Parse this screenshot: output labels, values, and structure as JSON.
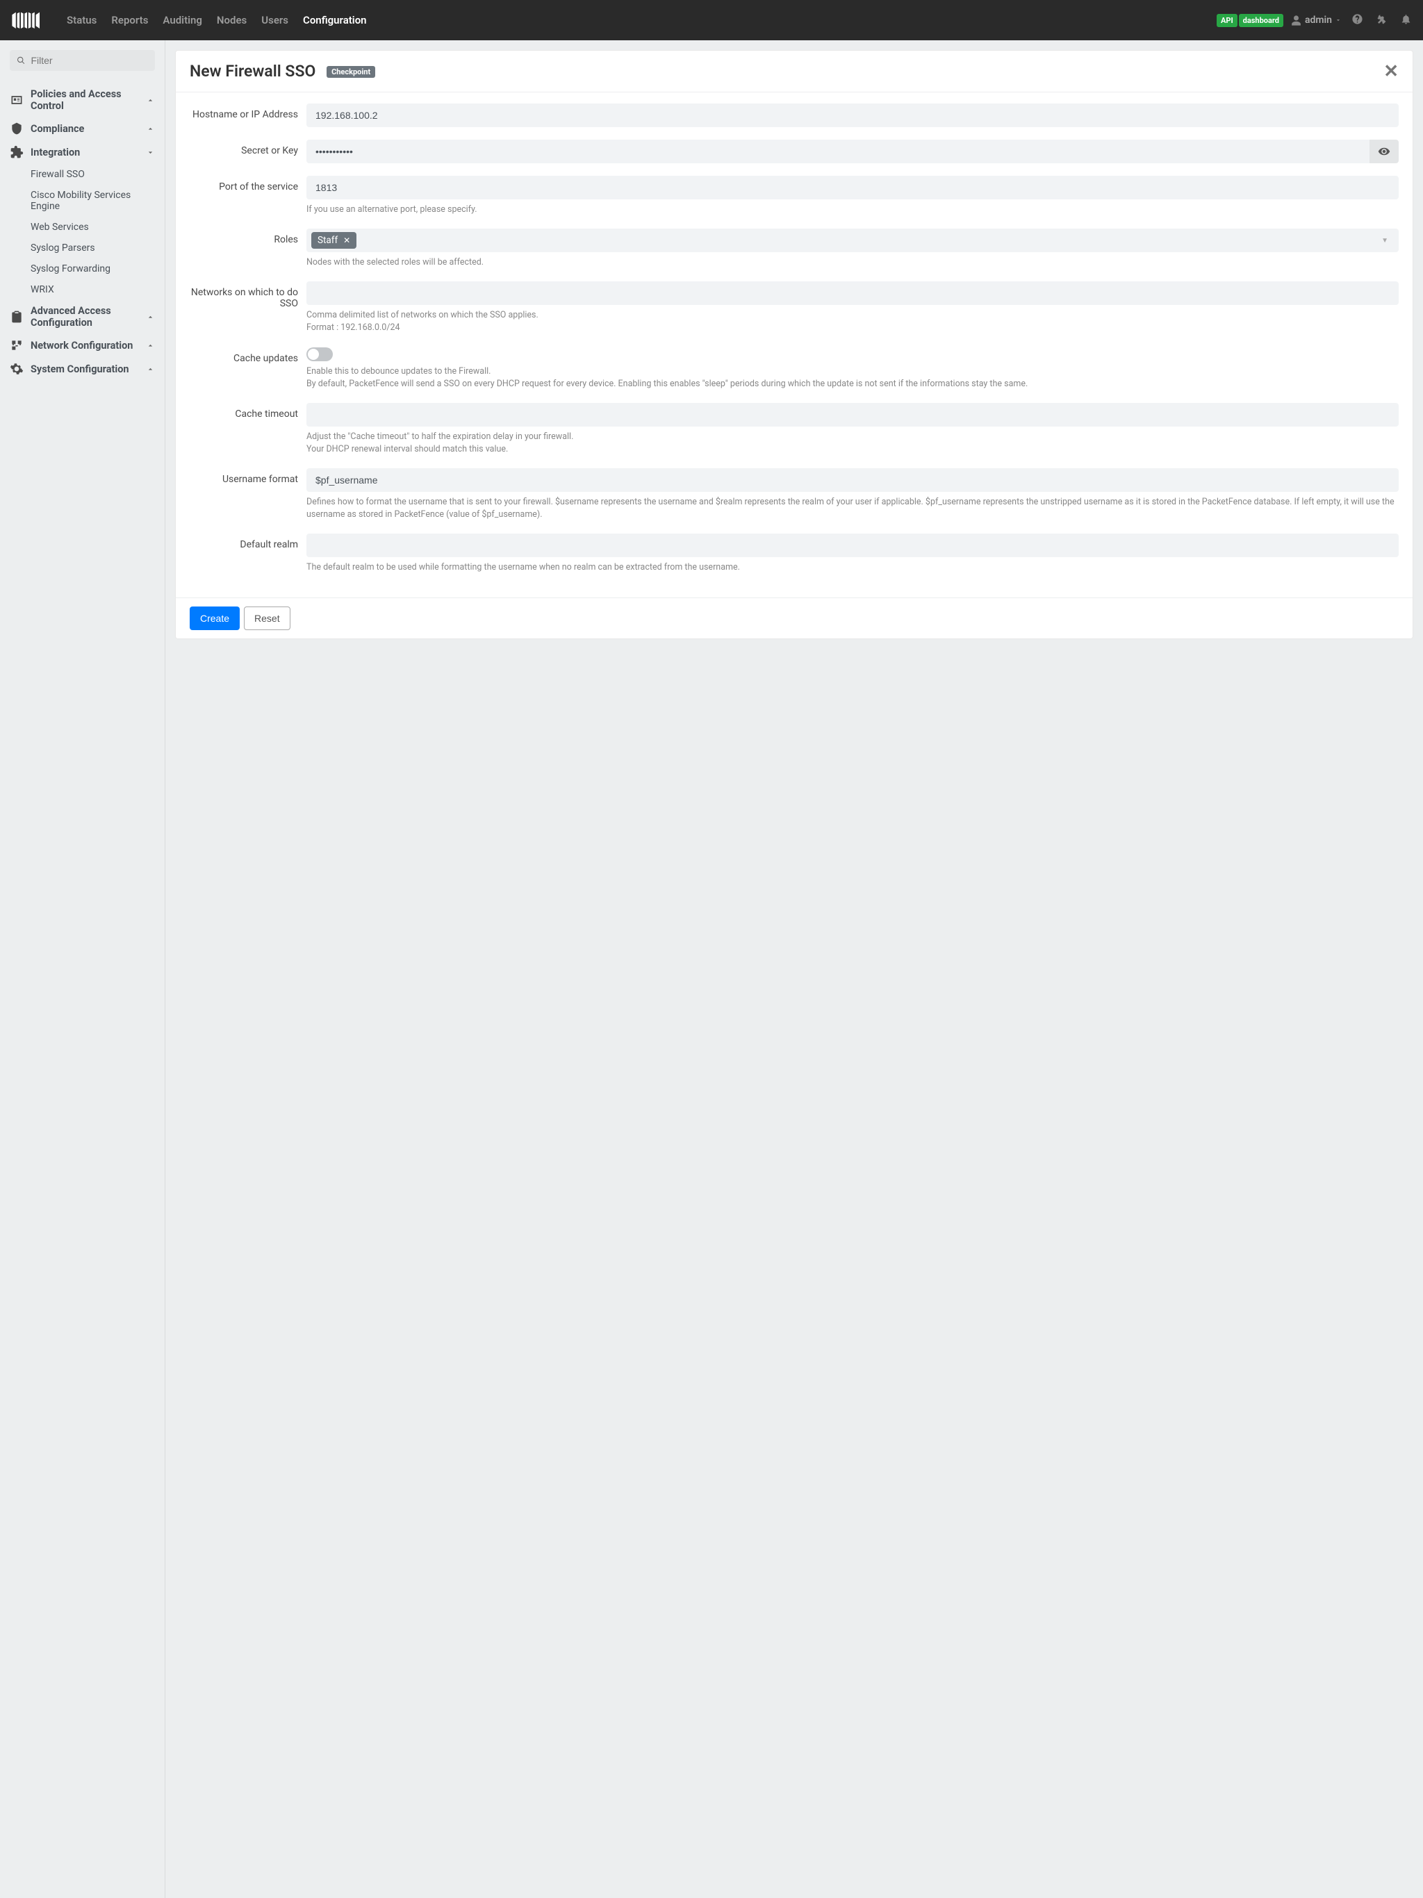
{
  "nav": {
    "items": [
      "Status",
      "Reports",
      "Auditing",
      "Nodes",
      "Users",
      "Configuration"
    ],
    "active_index": 5,
    "badges": {
      "api": "API",
      "dashboard": "dashboard"
    },
    "user": "admin"
  },
  "sidebar": {
    "filter_placeholder": "Filter",
    "sections": [
      {
        "label": "Policies and Access Control",
        "icon": "id-card-icon",
        "collapsed": true
      },
      {
        "label": "Compliance",
        "icon": "shield-icon",
        "collapsed": true
      },
      {
        "label": "Integration",
        "icon": "puzzle-icon",
        "collapsed": false,
        "items": [
          "Firewall SSO",
          "Cisco Mobility Services Engine",
          "Web Services",
          "Syslog Parsers",
          "Syslog Forwarding",
          "WRIX"
        ]
      },
      {
        "label": "Advanced Access Configuration",
        "icon": "clipboard-icon",
        "collapsed": true
      },
      {
        "label": "Network Configuration",
        "icon": "network-icon",
        "collapsed": true
      },
      {
        "label": "System Configuration",
        "icon": "gears-icon",
        "collapsed": true
      }
    ]
  },
  "form": {
    "title": "New Firewall SSO",
    "type_badge": "Checkpoint",
    "hostname": {
      "label": "Hostname or IP Address",
      "value": "192.168.100.2"
    },
    "secret": {
      "label": "Secret or Key",
      "value": "•••••••••••"
    },
    "port": {
      "label": "Port of the service",
      "value": "1813",
      "help": "If you use an alternative port, please specify."
    },
    "roles": {
      "label": "Roles",
      "tags": [
        "Staff"
      ],
      "help": "Nodes with the selected roles will be affected."
    },
    "networks": {
      "label": "Networks on which to do SSO",
      "value": "",
      "help1": "Comma delimited list of networks on which the SSO applies.",
      "help2": "Format : 192.168.0.0/24"
    },
    "cache_updates": {
      "label": "Cache updates",
      "on": false,
      "help1": "Enable this to debounce updates to the Firewall.",
      "help2": "By default, PacketFence will send a SSO on every DHCP request for every device. Enabling this enables \"sleep\" periods during which the update is not sent if the informations stay the same."
    },
    "cache_timeout": {
      "label": "Cache timeout",
      "value": "",
      "help1": "Adjust the \"Cache timeout\" to half the expiration delay in your firewall.",
      "help2": "Your DHCP renewal interval should match this value."
    },
    "username_format": {
      "label": "Username format",
      "value": "$pf_username",
      "help": "Defines how to format the username that is sent to your firewall. $username represents the username and $realm represents the realm of your user if applicable. $pf_username represents the unstripped username as it is stored in the PacketFence database. If left empty, it will use the username as stored in PacketFence (value of $pf_username)."
    },
    "default_realm": {
      "label": "Default realm",
      "value": "",
      "help": "The default realm to be used while formatting the username when no realm can be extracted from the username."
    },
    "buttons": {
      "create": "Create",
      "reset": "Reset"
    }
  }
}
